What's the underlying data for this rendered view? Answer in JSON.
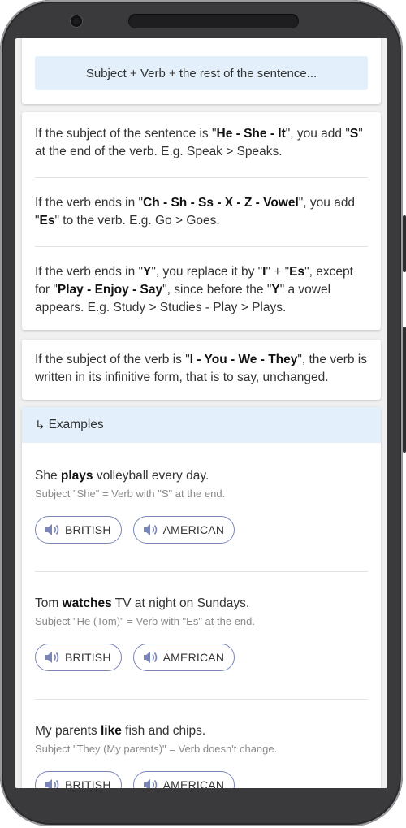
{
  "formula": "Subject + Verb + the rest of the sentence...",
  "rules": [
    {
      "parts": [
        {
          "t": "If the subject of the sentence is \""
        },
        {
          "t": "He - She - It",
          "b": true
        },
        {
          "t": "\", you add \""
        },
        {
          "t": "S",
          "b": true
        },
        {
          "t": "\" at the end of the verb. E.g. Speak > Speaks."
        }
      ]
    },
    {
      "parts": [
        {
          "t": "If the verb ends in \""
        },
        {
          "t": "Ch - Sh - Ss - X - Z - Vowel",
          "b": true
        },
        {
          "t": "\", you add \""
        },
        {
          "t": "Es",
          "b": true
        },
        {
          "t": "\" to the verb. E.g. Go > Goes."
        }
      ]
    },
    {
      "parts": [
        {
          "t": "If the verb ends in \""
        },
        {
          "t": "Y",
          "b": true
        },
        {
          "t": "\", you replace it by \""
        },
        {
          "t": "I",
          "b": true
        },
        {
          "t": "\" + \""
        },
        {
          "t": "Es",
          "b": true
        },
        {
          "t": "\", except for \""
        },
        {
          "t": "Play - Enjoy - Say",
          "b": true
        },
        {
          "t": "\", since before the \""
        },
        {
          "t": "Y",
          "b": true
        },
        {
          "t": "\" a vowel appears. E.g. Study > Studies - Play > Plays."
        }
      ]
    },
    {
      "parts": [
        {
          "t": "If the subject of the verb is \""
        },
        {
          "t": "I - You - We - They",
          "b": true
        },
        {
          "t": "\", the verb is written in its infinitive form, that is to say, unchanged."
        }
      ]
    }
  ],
  "examples_header": {
    "arrow": "↳",
    "label": "Examples"
  },
  "examples": [
    {
      "sentence": [
        {
          "t": "She "
        },
        {
          "t": "plays",
          "b": true
        },
        {
          "t": " volleyball every day."
        }
      ],
      "note": "Subject \"She\" = Verb with \"S\" at the end.",
      "buttons": [
        "BRITISH",
        "AMERICAN"
      ]
    },
    {
      "sentence": [
        {
          "t": "Tom "
        },
        {
          "t": "watches",
          "b": true
        },
        {
          "t": " TV at night on Sundays."
        }
      ],
      "note": "Subject \"He (Tom)\" = Verb with \"Es\" at the end.",
      "buttons": [
        "BRITISH",
        "AMERICAN"
      ]
    },
    {
      "sentence": [
        {
          "t": "My parents "
        },
        {
          "t": "like",
          "b": true
        },
        {
          "t": " fish and chips."
        }
      ],
      "note": "Subject \"They (My parents)\" = Verb doesn't change.",
      "buttons": [
        "BRITISH",
        "AMERICAN"
      ]
    }
  ],
  "colors": {
    "accent_bg": "#e3f0fb",
    "button_border": "#7b86b8",
    "speaker_icon": "#7b86b8"
  }
}
